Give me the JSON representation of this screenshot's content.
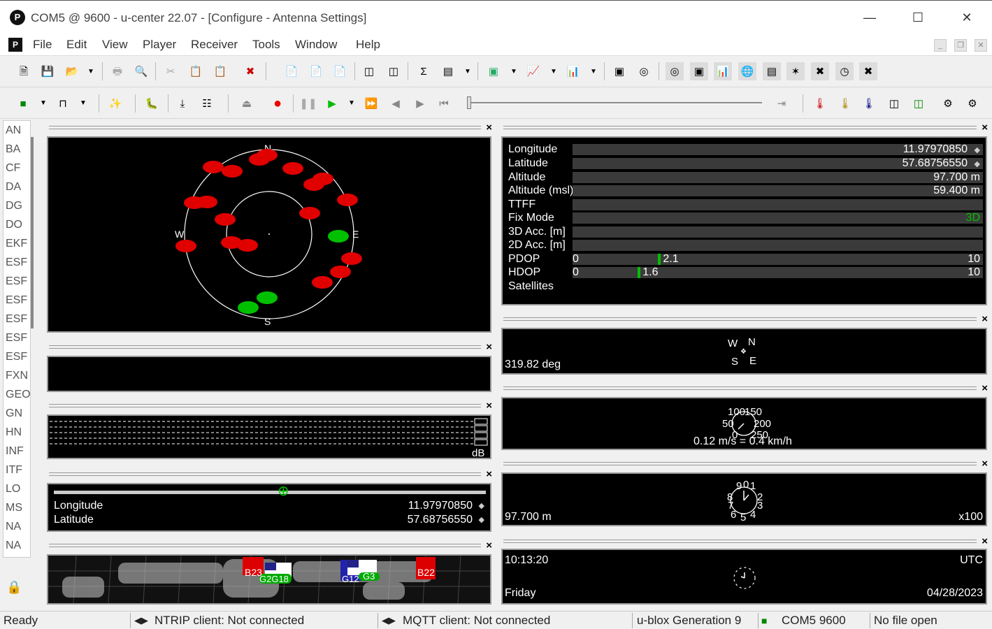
{
  "window": {
    "title": "COM5 @ 9600 - u-center 22.07 - [Configure - Antenna Settings]",
    "logo": "P",
    "controls": [
      "minimize",
      "maximize",
      "close"
    ]
  },
  "menubar": {
    "items": [
      "File",
      "Edit",
      "View",
      "Player",
      "Receiver",
      "Tools",
      "Window",
      "Help"
    ]
  },
  "sidebar": {
    "items": [
      "AN",
      "BA",
      "CF",
      "DA",
      "DG",
      "DO",
      "EKF",
      "ESF",
      "ESF",
      "ESF",
      "ESF",
      "ESF",
      "ESF",
      "FXN",
      "GEO",
      "GN",
      "HN",
      "INF",
      "ITF",
      "LO",
      "MS",
      "NA",
      "NA"
    ]
  },
  "skyview": {
    "labels": {
      "north": "N",
      "south": "S",
      "east": "E",
      "west": "W"
    },
    "satellites_colors": {
      "not_used": "#e00000",
      "used": "#00c000"
    }
  },
  "signal_pane": {
    "unit": "dB"
  },
  "position_strip": {
    "longitude_label": "Longitude",
    "longitude_value": "11.97970850",
    "latitude_label": "Latitude",
    "latitude_value": "57.68756550"
  },
  "world_map": {
    "flags": [
      "B23",
      "G2G18",
      "G12",
      "G3",
      "B22"
    ]
  },
  "data_view": {
    "rows": [
      {
        "label": "Longitude",
        "value": "11.97970850"
      },
      {
        "label": "Latitude",
        "value": "57.68756550"
      },
      {
        "label": "Altitude",
        "value": "97.700 m"
      },
      {
        "label": "Altitude (msl)",
        "value": "59.400 m"
      },
      {
        "label": "TTFF",
        "value": ""
      },
      {
        "label": "Fix Mode",
        "value": "3D"
      },
      {
        "label": "3D Acc. [m]",
        "value": ""
      },
      {
        "label": "2D Acc. [m]",
        "value": ""
      }
    ],
    "pdop": {
      "label": "PDOP",
      "min": "0",
      "max": "10",
      "value": "2.1",
      "fraction": 0.21
    },
    "hdop": {
      "label": "HDOP",
      "min": "0",
      "max": "10",
      "value": "1.6",
      "fraction": 0.16
    },
    "satellites_label": "Satellites",
    "fix_color": "#00c000"
  },
  "compass": {
    "heading": "319.82 deg",
    "labels": {
      "n": "N",
      "w": "W",
      "s": "S",
      "e": "E"
    }
  },
  "speedometer": {
    "scale": [
      "100",
      "150",
      "50",
      "200",
      "0",
      "250"
    ],
    "reading": "0.12 m/s = 0.4 km/h"
  },
  "altimeter": {
    "value": "97.700 m",
    "multiplier": "x100",
    "dial": [
      "9",
      "0",
      "1",
      "8",
      "2",
      "7",
      "3",
      "6",
      "5",
      "4"
    ]
  },
  "clock": {
    "time": "10:13:20",
    "zone": "UTC",
    "day": "Friday",
    "date": "04/28/2023"
  },
  "statusbar": {
    "ready": "Ready",
    "ntrip": "NTRIP client: Not connected",
    "mqtt": "MQTT client: Not connected",
    "generation": "u-blox Generation 9",
    "port": "COM5 9600",
    "file": "No file open"
  }
}
